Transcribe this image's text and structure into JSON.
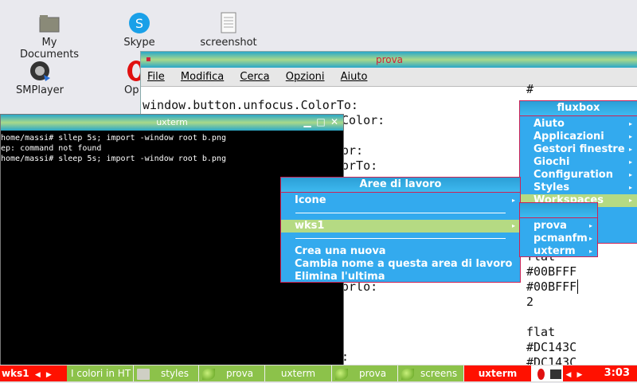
{
  "desktop": {
    "icons": [
      {
        "label": "My Documents"
      },
      {
        "label": "Skype"
      },
      {
        "label": "screenshot"
      },
      {
        "label": "SMPlayer"
      },
      {
        "label": "Op"
      }
    ]
  },
  "prova_window": {
    "title": "prova",
    "menu": [
      "File",
      "Modifica",
      "Cerca",
      "Opzioni",
      "Aiuto"
    ],
    "lines": {
      "l1": "window.button.unfocus.ColorTo:",
      "l2": "Color:",
      "l3": "or:",
      "l4": "orTo:",
      "l5": "orlo:",
      "r1": "#",
      "r2": "flat",
      "r3": "#00BFFF",
      "r4": "#00BFFF",
      "r5": "2",
      "r6": "flat",
      "r7": "#DC143C",
      "r8": "#DC143C",
      "dot": ":"
    }
  },
  "uxterm_window": {
    "title": "uxterm",
    "lines": [
      "home/massi# sllep 5s; import -window root b.png",
      "ep: command not found",
      "home/massi# sleep 5s; import -window root b.png"
    ]
  },
  "fluxbox_menu": {
    "title": "fluxbox",
    "items": [
      "Aiuto",
      "Applicazioni",
      "Gestori finestre",
      "Giochi",
      "Configuration",
      "Styles",
      "Workspaces",
      "..."
    ]
  },
  "workspace_menu": {
    "title": "Aree di lavoro",
    "items": [
      "Icone",
      "wks1",
      "Crea una nuova",
      "Cambia nome a questa area di lavoro",
      "Elimina l'ultima"
    ]
  },
  "wks1_menu": {
    "items": [
      "prova",
      "pcmanfm",
      "uxterm"
    ]
  },
  "taskbar": {
    "workspace": "wks1",
    "tasks": [
      "I colori in HT",
      "styles",
      "prova",
      "uxterm",
      "prova",
      "screens",
      "uxterm"
    ],
    "clock": "3:03"
  },
  "colors": {
    "menu_bg": "#33aaee",
    "menu_border": "#cc2255",
    "menu_selected": "#b5da83",
    "taskbar_red": "#ff1100",
    "taskbar_green": "#8cc24a"
  }
}
